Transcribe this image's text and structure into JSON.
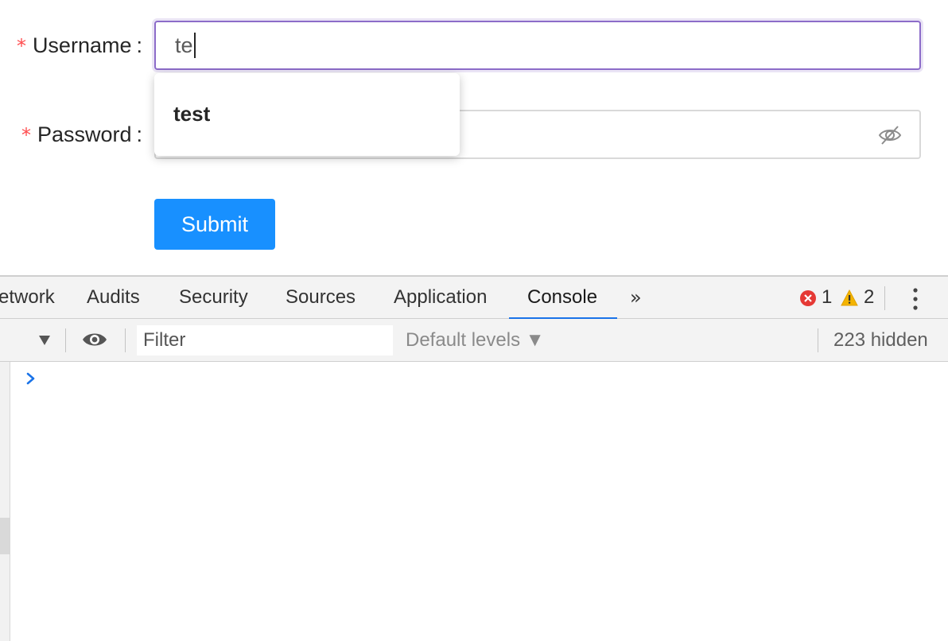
{
  "form": {
    "username": {
      "required_mark": "*",
      "label": "Username",
      "colon": ":",
      "value": "te"
    },
    "autocomplete": {
      "items": [
        "test"
      ]
    },
    "password": {
      "required_mark": "*",
      "label": "Password",
      "colon": ":",
      "value": "",
      "toggle_icon": "eye-invisible-icon"
    },
    "submit_label": "Submit",
    "colors": {
      "required": "#ff4d4f",
      "primary": "#1890ff",
      "focus_border": "#8c6cc9"
    }
  },
  "devtools": {
    "tabs": [
      {
        "label": "etwork",
        "active": false
      },
      {
        "label": "Audits",
        "active": false
      },
      {
        "label": "Security",
        "active": false
      },
      {
        "label": "Sources",
        "active": false
      },
      {
        "label": "Application",
        "active": false
      },
      {
        "label": "Console",
        "active": true
      }
    ],
    "more_tabs_glyph": "»",
    "errors": "1",
    "warnings": "2",
    "toolbar": {
      "filter_placeholder": "Filter",
      "levels_label": "Default levels ▼",
      "hidden_count": "223 hidden"
    },
    "colors": {
      "active_tab_underline": "#1a73e8",
      "error": "#e53935",
      "warning": "#f4b400"
    }
  }
}
